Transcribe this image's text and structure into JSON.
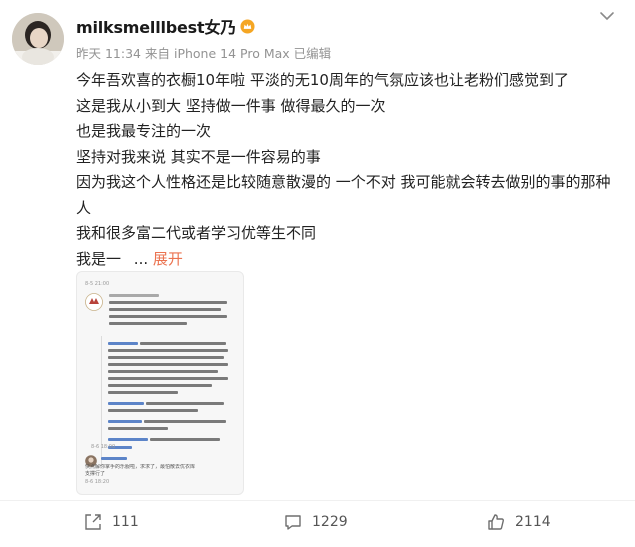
{
  "post": {
    "username": "milksmelllbest女乃",
    "vip_icon": "vip-crown-icon",
    "time": "昨天 11:34",
    "source": "来自 iPhone 14 Pro Max",
    "edited": "已编辑",
    "content_lines": [
      "今年吾欢喜的衣橱10年啦 平淡的无10周年的气氛应该也让老粉们感觉到了",
      "这是我从小到大 坚持做一件事 做得最久的一次",
      "也是我最专注的一次",
      "坚持对我来说 其实不是一件容易的事",
      "因为我这个人性格还是比较随意散漫的 一个不对 我可能就会转去做别的事的那种",
      "人",
      "我和很多富二代或者学习优等生不同"
    ],
    "last_line_text": "我是一",
    "ellipsis": "...",
    "expand_label": "展开"
  },
  "thumbnail": {
    "top_timestamp": "8-5 21:00",
    "mid_timestamp": "8-6 18:00",
    "bottom_timestamp": "8-6 18:20",
    "bottom_caption_1": "快点解你掌手的乐服啦，求求了，最怕散去优衣库",
    "bottom_caption_2": "支撑行了"
  },
  "footer": {
    "repost_count": "111",
    "comment_count": "1229",
    "like_count": "2114"
  },
  "colors": {
    "accent_orange": "#eb7350",
    "meta_gray": "#939393",
    "vip_gold": "#f5a623"
  }
}
